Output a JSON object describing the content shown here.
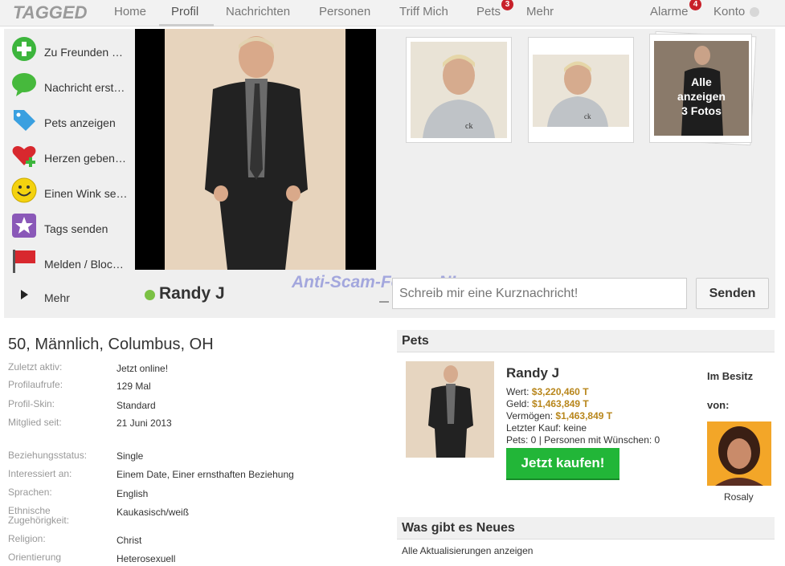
{
  "logo": "TAGGED",
  "nav": {
    "items": [
      "Home",
      "Profil",
      "Nachrichten",
      "Personen",
      "Triff Mich",
      "Pets",
      "Mehr"
    ],
    "pets_badge": "3",
    "alarme": "Alarme",
    "alarme_badge": "4",
    "konto": "Konto"
  },
  "sidebar": {
    "items": [
      {
        "label": "Zu Freunden …",
        "icon": "add-friend-icon"
      },
      {
        "label": "Nachricht erst…",
        "icon": "message-icon"
      },
      {
        "label": "Pets anzeigen",
        "icon": "tag-icon"
      },
      {
        "label": "Herzen geben…",
        "icon": "heart-icon"
      },
      {
        "label": "Einen Wink se…",
        "icon": "smiley-icon"
      },
      {
        "label": "Tags senden",
        "icon": "star-icon"
      },
      {
        "label": "Melden / Bloc…",
        "icon": "flag-icon"
      },
      {
        "label": "Mehr",
        "icon": "triangle-right-icon"
      }
    ]
  },
  "photos": {
    "all_label_1": "Alle",
    "all_label_2": "anzeigen",
    "all_label_3": "3 Fotos"
  },
  "profile": {
    "name": "Randy J",
    "watermark": "Anti-Scam-Forum-NL",
    "message_placeholder": "Schreib mir eine Kurznachricht!",
    "send": "Senden",
    "headline": "50, Männlich, Columbus, OH",
    "info": [
      {
        "label": "Zuletzt aktiv:",
        "value": "Jetzt online!"
      },
      {
        "label": "Profilaufrufe:",
        "value": "129 Mal"
      },
      {
        "label": "Profil-Skin:",
        "value": "Standard"
      },
      {
        "label": "Mitglied seit:",
        "value": "21 Juni 2013"
      },
      {
        "label": "Beziehungsstatus:",
        "value": "Single"
      },
      {
        "label": "Interessiert an:",
        "value": "Einem Date, Einer ernsthaften Beziehung"
      },
      {
        "label": "Sprachen:",
        "value": "English"
      },
      {
        "label": "Ethnische Zugehörigkeit:",
        "value": "Kaukasisch/weiß"
      },
      {
        "label": "Religion:",
        "value": "Christ"
      },
      {
        "label": "Orientierung",
        "value": "Heterosexuell"
      }
    ]
  },
  "pets": {
    "title": "Pets",
    "name": "Randy J",
    "wert_label": "Wert:",
    "wert": "$3,220,460 T",
    "geld_label": "Geld:",
    "geld": "$1,463,849 T",
    "vermoegen_label": "Vermögen:",
    "vermoegen": "$1,463,849 T",
    "letzter_kauf": "Letzter Kauf: keine",
    "pets_line": "Pets: 0 | Personen mit Wünschen: 0",
    "buy": "Jetzt kaufen!",
    "owned_1": "Im Besitz",
    "owned_2": "von:",
    "owner": "Rosaly"
  },
  "news": {
    "title": "Was gibt es Neues",
    "link": "Alle Aktualisierungen anzeigen"
  }
}
